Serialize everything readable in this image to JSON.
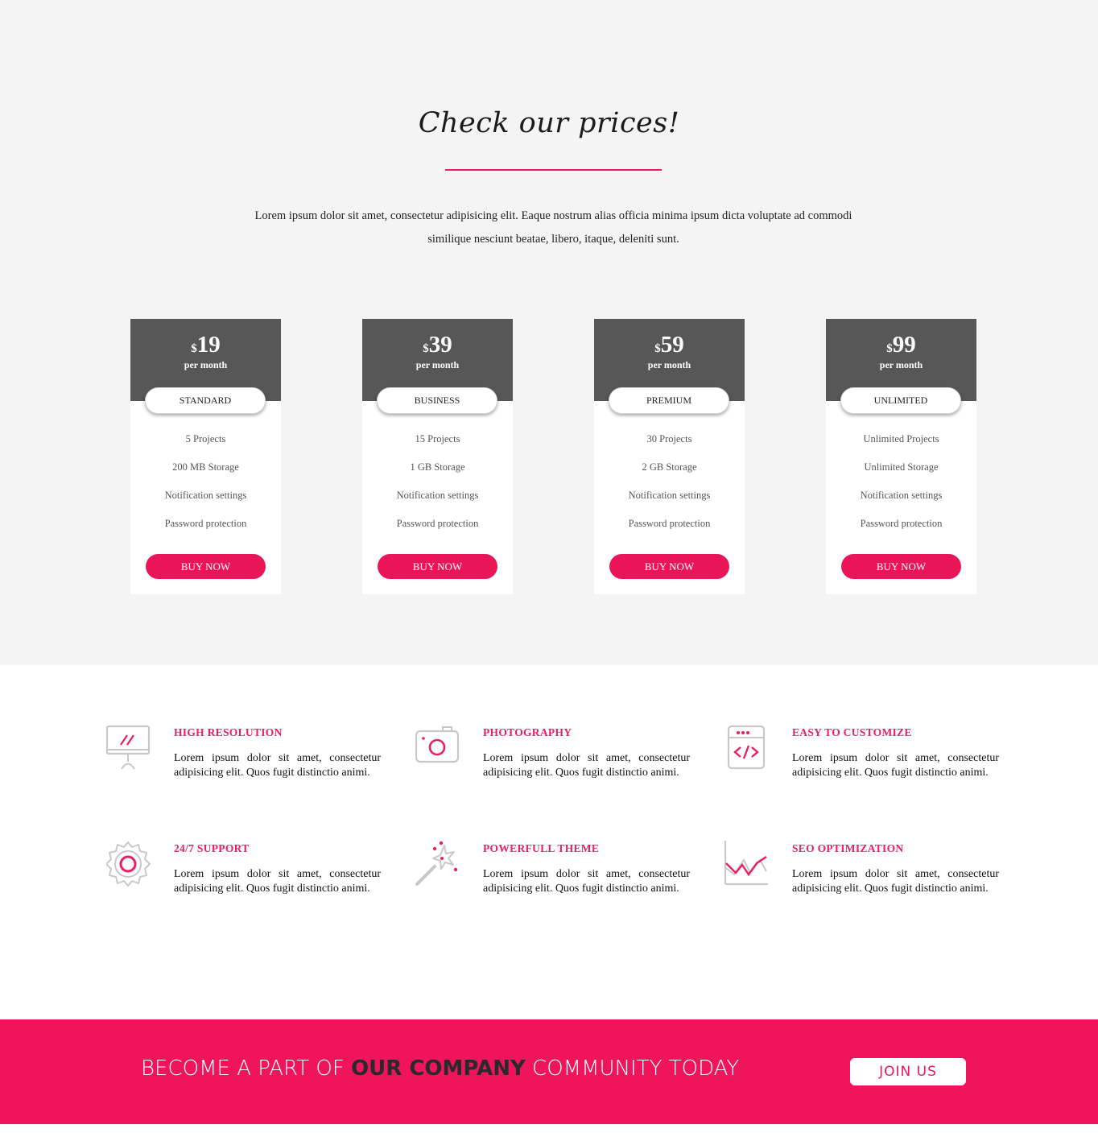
{
  "pricing": {
    "title": "Check our prices!",
    "description": "Lorem ipsum dolor sit amet, consectetur adipisicing elit. Eaque nostrum alias officia minima ipsum dicta voluptate ad commodi similique nesciunt beatae, libero, itaque, deleniti sunt.",
    "plans": [
      {
        "currency": "$",
        "price": "19",
        "period": "per month",
        "name": "STANDARD",
        "features": [
          "5 Projects",
          "200 MB Storage",
          "Notification settings",
          "Password protection"
        ],
        "button": "BUY NOW"
      },
      {
        "currency": "$",
        "price": "39",
        "period": "per month",
        "name": "BUSINESS",
        "features": [
          "15 Projects",
          "1 GB Storage",
          "Notification settings",
          "Password protection"
        ],
        "button": "BUY NOW"
      },
      {
        "currency": "$",
        "price": "59",
        "period": "per month",
        "name": "PREMIUM",
        "features": [
          "30 Projects",
          "2 GB Storage",
          "Notification settings",
          "Password protection"
        ],
        "button": "BUY NOW"
      },
      {
        "currency": "$",
        "price": "99",
        "period": "per month",
        "name": "UNLIMITED",
        "features": [
          "Unlimited Projects",
          "Unlimited Storage",
          "Notification settings",
          "Password protection"
        ],
        "button": "BUY NOW"
      }
    ]
  },
  "features": [
    {
      "icon": "monitor-icon",
      "title": "HIGH RESOLUTION",
      "text": "Lorem ipsum dolor sit amet, consectetur adipisicing elit. Quos fugit distinctio animi."
    },
    {
      "icon": "camera-icon",
      "title": "PHOTOGRAPHY",
      "text": "Lorem ipsum dolor sit amet, consectetur adipisicing elit. Quos fugit distinctio animi."
    },
    {
      "icon": "code-icon",
      "title": "EASY TO CUSTOMIZE",
      "text": "Lorem ipsum dolor sit amet, consectetur adipisicing elit. Quos fugit distinctio animi."
    },
    {
      "icon": "gear-icon",
      "title": "24/7 SUPPORT",
      "text": "Lorem ipsum dolor sit amet, consectetur adipisicing elit. Quos fugit distinctio animi."
    },
    {
      "icon": "magic-wand-icon",
      "title": "POWERFULL THEME",
      "text": "Lorem ipsum dolor sit amet, consectetur adipisicing elit. Quos fugit distinctio animi."
    },
    {
      "icon": "line-chart-icon",
      "title": "SEO OPTIMIZATION",
      "text": "Lorem ipsum dolor sit amet, consectetur adipisicing elit. Quos fugit distinctio animi."
    }
  ],
  "cta": {
    "text_before": "BECOME A PART OF ",
    "text_bold": "OUR COMPANY",
    "text_after": " COMMUNITY TODAY",
    "button": "JOIN US"
  },
  "colors": {
    "accent": "#e91e63",
    "card_header": "#575757",
    "section_bg": "#f4f4f4",
    "cta_bg": "#ef145c"
  }
}
